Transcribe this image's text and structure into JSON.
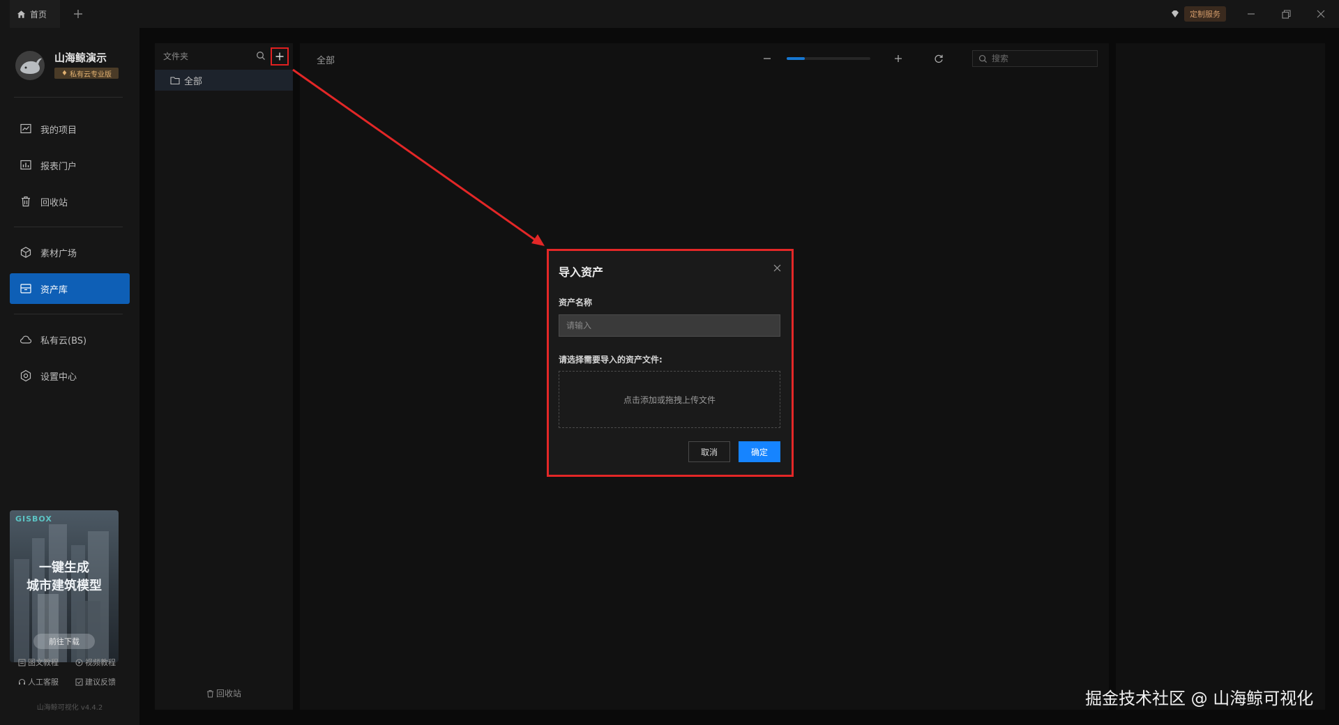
{
  "titlebar": {
    "home_tab": "首页",
    "custom_service": "定制服务"
  },
  "sidebar": {
    "app_name": "山海鲸演示",
    "edition": "私有云专业版",
    "items": [
      {
        "label": "我的项目",
        "icon": "chart-line-icon"
      },
      {
        "label": "报表门户",
        "icon": "bar-chart-icon"
      },
      {
        "label": "回收站",
        "icon": "trash-icon"
      },
      {
        "label": "素材广场",
        "icon": "cube-icon"
      },
      {
        "label": "资产库",
        "icon": "archive-box-icon",
        "active": true
      },
      {
        "label": "私有云(BS)",
        "icon": "cloud-icon"
      },
      {
        "label": "设置中心",
        "icon": "gear-icon"
      }
    ],
    "promo": {
      "logo": "GISBOX",
      "line1": "一键生成",
      "line2": "城市建筑模型",
      "button": "前往下载"
    },
    "links": {
      "doc_tutorial": "图文教程",
      "video_tutorial": "视频教程",
      "support": "人工客服",
      "feedback": "建议反馈"
    },
    "version": "山海鲸可视化 v4.4.2"
  },
  "folder_panel": {
    "title": "文件夹",
    "all": "全部",
    "recycle": "回收站"
  },
  "main": {
    "title": "全部",
    "zoom_level": 0.22,
    "search_placeholder": "搜索"
  },
  "dialog": {
    "title": "导入资产",
    "name_label": "资产名称",
    "name_placeholder": "请输入",
    "file_label": "请选择需要导入的资产文件:",
    "dropzone_text": "点击添加或拖拽上传文件",
    "cancel": "取消",
    "ok": "确定"
  },
  "colors": {
    "accent": "#1684ff",
    "nav_active": "#0e5fb6",
    "highlight_red": "#e32727"
  },
  "watermark": "掘金技术社区 @ 山海鲸可视化"
}
